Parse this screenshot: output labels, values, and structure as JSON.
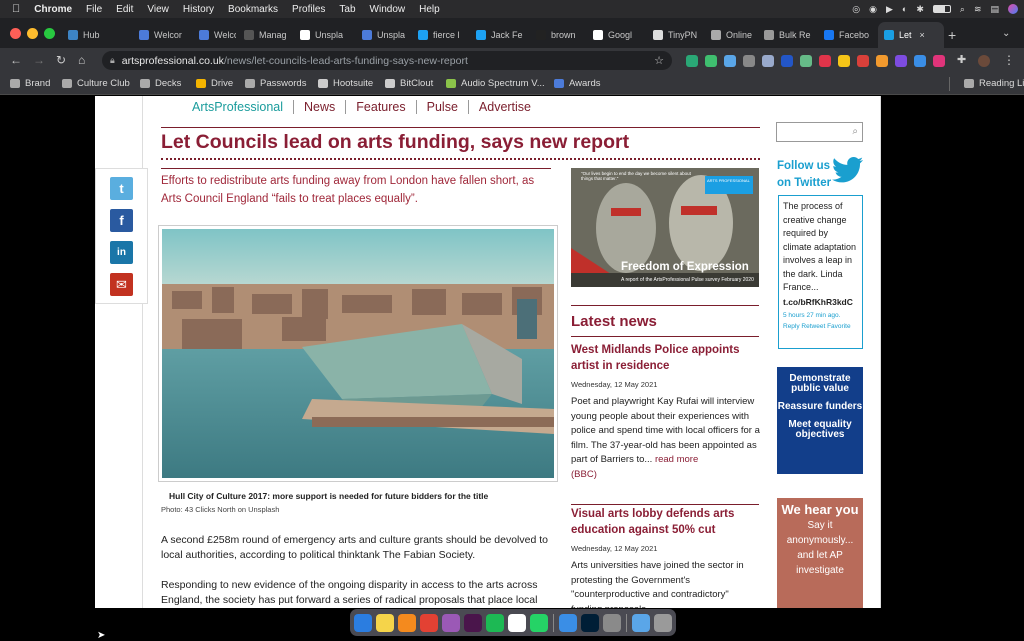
{
  "menubar": {
    "apple": "",
    "app": "Chrome",
    "items": [
      "File",
      "Edit",
      "View",
      "History",
      "Bookmarks",
      "Profiles",
      "Tab",
      "Window",
      "Help"
    ]
  },
  "tabs": [
    {
      "label": "Hub",
      "color": "#3d84c4"
    },
    {
      "label": "Welcor",
      "color": "#4c7bd9"
    },
    {
      "label": "Welcor",
      "color": "#4c7bd9"
    },
    {
      "label": "Manag",
      "color": "#555"
    },
    {
      "label": "Unspla",
      "color": "#fff"
    },
    {
      "label": "Unspla",
      "color": "#4c7bd9"
    },
    {
      "label": "fierce l",
      "color": "#1da1f2"
    },
    {
      "label": "Jack Fe",
      "color": "#1da1f2"
    },
    {
      "label": "brown",
      "color": "#222"
    },
    {
      "label": "Googl",
      "color": "#fff"
    },
    {
      "label": "TinyPN",
      "color": "#ddd"
    },
    {
      "label": "Online",
      "color": "#aaa"
    },
    {
      "label": "Bulk Re",
      "color": "#999"
    },
    {
      "label": "Facebo",
      "color": "#1877f2"
    },
    {
      "label": "Let",
      "color": "#1a9fe3",
      "active": true
    }
  ],
  "addressbar": {
    "domain": "artsprofessional.co.uk",
    "path": "/news/let-councils-lead-arts-funding-says-new-report"
  },
  "bookmarks": [
    {
      "label": "Brand",
      "color": "#aaa"
    },
    {
      "label": "Culture Club",
      "color": "#aaa"
    },
    {
      "label": "Decks",
      "color": "#aaa"
    },
    {
      "label": "Drive",
      "color": "#f4b400"
    },
    {
      "label": "Passwords",
      "color": "#aaa"
    },
    {
      "label": "Hootsuite",
      "color": "#ccc"
    },
    {
      "label": "BitClout",
      "color": "#ccc"
    },
    {
      "label": "Audio Spectrum V...",
      "color": "#8bc34a"
    },
    {
      "label": "Awards",
      "color": "#4c7bd9"
    }
  ],
  "reading_list": "Reading List",
  "site": {
    "nav": [
      "ArtsProfessional",
      "News",
      "Features",
      "Pulse",
      "Advertise"
    ],
    "headline": "Let Councils lead on arts funding, says new report",
    "standfirst": "Efforts to redistribute arts funding away from London have fallen short, as Arts Council England “fails to treat places equally”.",
    "caption": "Hull City of Culture 2017: more support is needed for future bidders for the title",
    "credit": "Photo: 43 Clicks North on Unsplash",
    "para1": "A second £258m round of emergency arts and culture grants should be devolved to local authorities, according to political thinktank The Fabian Society.",
    "para2": "Responding to new evidence of the ongoing disparity in access to the arts across England, the society has put forward a series of radical proposals that place local",
    "share": [
      "t",
      "f",
      "in",
      "✉"
    ],
    "promo": {
      "quote": "\"Our lives begin to end the day we become silent about things that matter.\"",
      "logo": "ARTS PROFESSIONAL",
      "title": "Freedom of Expression",
      "sub": "A report of the ArtsProfessional Pulse survey",
      "date": "February 2020"
    },
    "latest_heading": "Latest news",
    "news": [
      {
        "title": "West Midlands Police appoints artist in residence",
        "date": "Wednesday, 12 May 2021",
        "body": "Poet and playwright Kay Rufai will interview young people about their experiences with police and spend time with local officers for a film. The 37-year-old has been appointed as part of Barriers to... ",
        "more": "read more",
        "source": "(BBC)"
      },
      {
        "title": "Visual arts lobby defends arts education against 50% cut",
        "date": "Wednesday, 12 May 2021",
        "body": "Arts universities have joined the sector in protesting the Government's \"counterproductive and contradictory\" funding proposals"
      }
    ],
    "follow": [
      "Follow us",
      "on Twitter"
    ],
    "tweet": {
      "text": "The process of creative change required by climate adaptation involves a leap in the dark. Linda France...",
      "link": "t.co/bRfKhR3kdC",
      "time": "5 hours 27 min ago.",
      "actions": "Reply Retweet Favorite"
    },
    "ad1": [
      "Demonstrate public value",
      "Reassure funders",
      "Meet equality objectives"
    ],
    "ad2": {
      "big": "We hear you",
      "lines": [
        "Say it",
        "anonymously...",
        "and let AP",
        "investigate"
      ]
    }
  },
  "dock": [
    {
      "name": "finder",
      "color": "#2b7de0"
    },
    {
      "name": "notes",
      "color": "#f5d44a"
    },
    {
      "name": "sublime",
      "color": "#f48a1e"
    },
    {
      "name": "chrome",
      "color": "#e34133"
    },
    {
      "name": "figma",
      "color": "#9b59b6"
    },
    {
      "name": "slack",
      "color": "#4a154b"
    },
    {
      "name": "spotify",
      "color": "#1db954"
    },
    {
      "name": "notion",
      "color": "#ffffff"
    },
    {
      "name": "whatsapp",
      "color": "#25d366"
    },
    {
      "name": "mail",
      "color": "#3a8ee6"
    },
    {
      "name": "photoshop",
      "color": "#001e36"
    },
    {
      "name": "preview",
      "color": "#8a8a8a"
    },
    {
      "name": "folder",
      "color": "#5aa6e8"
    },
    {
      "name": "trash",
      "color": "#9a9a9a"
    }
  ]
}
